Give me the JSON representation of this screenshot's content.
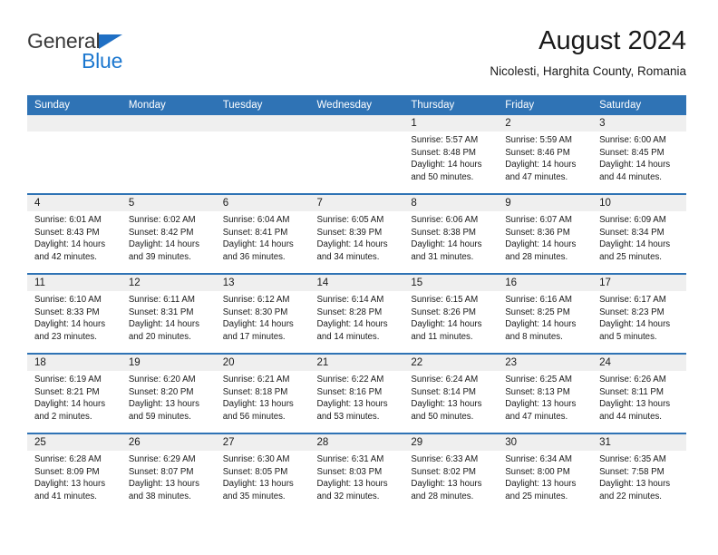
{
  "brand": {
    "name_part1": "General",
    "name_part2": "Blue",
    "triangle_color": "#1f6fc4",
    "blue_color": "#1b77cf"
  },
  "header": {
    "title": "August 2024",
    "subtitle": "Nicolesti, Harghita County, Romania"
  },
  "theme": {
    "header_bg": "#2f73b5",
    "daynum_bg": "#efefef",
    "row_separator": "#2f73b5",
    "text": "#1a1a1a"
  },
  "weekdays": [
    "Sunday",
    "Monday",
    "Tuesday",
    "Wednesday",
    "Thursday",
    "Friday",
    "Saturday"
  ],
  "labels": {
    "sunrise_prefix": "Sunrise:",
    "sunset_prefix": "Sunset:",
    "daylight_prefix": "Daylight:"
  },
  "weeks": [
    [
      {
        "day": "",
        "empty": true
      },
      {
        "day": "",
        "empty": true
      },
      {
        "day": "",
        "empty": true
      },
      {
        "day": "",
        "empty": true
      },
      {
        "day": "1",
        "sunrise": "Sunrise: 5:57 AM",
        "sunset": "Sunset: 8:48 PM",
        "daylight_1": "Daylight: 14 hours",
        "daylight_2": "and 50 minutes."
      },
      {
        "day": "2",
        "sunrise": "Sunrise: 5:59 AM",
        "sunset": "Sunset: 8:46 PM",
        "daylight_1": "Daylight: 14 hours",
        "daylight_2": "and 47 minutes."
      },
      {
        "day": "3",
        "sunrise": "Sunrise: 6:00 AM",
        "sunset": "Sunset: 8:45 PM",
        "daylight_1": "Daylight: 14 hours",
        "daylight_2": "and 44 minutes."
      }
    ],
    [
      {
        "day": "4",
        "sunrise": "Sunrise: 6:01 AM",
        "sunset": "Sunset: 8:43 PM",
        "daylight_1": "Daylight: 14 hours",
        "daylight_2": "and 42 minutes."
      },
      {
        "day": "5",
        "sunrise": "Sunrise: 6:02 AM",
        "sunset": "Sunset: 8:42 PM",
        "daylight_1": "Daylight: 14 hours",
        "daylight_2": "and 39 minutes."
      },
      {
        "day": "6",
        "sunrise": "Sunrise: 6:04 AM",
        "sunset": "Sunset: 8:41 PM",
        "daylight_1": "Daylight: 14 hours",
        "daylight_2": "and 36 minutes."
      },
      {
        "day": "7",
        "sunrise": "Sunrise: 6:05 AM",
        "sunset": "Sunset: 8:39 PM",
        "daylight_1": "Daylight: 14 hours",
        "daylight_2": "and 34 minutes."
      },
      {
        "day": "8",
        "sunrise": "Sunrise: 6:06 AM",
        "sunset": "Sunset: 8:38 PM",
        "daylight_1": "Daylight: 14 hours",
        "daylight_2": "and 31 minutes."
      },
      {
        "day": "9",
        "sunrise": "Sunrise: 6:07 AM",
        "sunset": "Sunset: 8:36 PM",
        "daylight_1": "Daylight: 14 hours",
        "daylight_2": "and 28 minutes."
      },
      {
        "day": "10",
        "sunrise": "Sunrise: 6:09 AM",
        "sunset": "Sunset: 8:34 PM",
        "daylight_1": "Daylight: 14 hours",
        "daylight_2": "and 25 minutes."
      }
    ],
    [
      {
        "day": "11",
        "sunrise": "Sunrise: 6:10 AM",
        "sunset": "Sunset: 8:33 PM",
        "daylight_1": "Daylight: 14 hours",
        "daylight_2": "and 23 minutes."
      },
      {
        "day": "12",
        "sunrise": "Sunrise: 6:11 AM",
        "sunset": "Sunset: 8:31 PM",
        "daylight_1": "Daylight: 14 hours",
        "daylight_2": "and 20 minutes."
      },
      {
        "day": "13",
        "sunrise": "Sunrise: 6:12 AM",
        "sunset": "Sunset: 8:30 PM",
        "daylight_1": "Daylight: 14 hours",
        "daylight_2": "and 17 minutes."
      },
      {
        "day": "14",
        "sunrise": "Sunrise: 6:14 AM",
        "sunset": "Sunset: 8:28 PM",
        "daylight_1": "Daylight: 14 hours",
        "daylight_2": "and 14 minutes."
      },
      {
        "day": "15",
        "sunrise": "Sunrise: 6:15 AM",
        "sunset": "Sunset: 8:26 PM",
        "daylight_1": "Daylight: 14 hours",
        "daylight_2": "and 11 minutes."
      },
      {
        "day": "16",
        "sunrise": "Sunrise: 6:16 AM",
        "sunset": "Sunset: 8:25 PM",
        "daylight_1": "Daylight: 14 hours",
        "daylight_2": "and 8 minutes."
      },
      {
        "day": "17",
        "sunrise": "Sunrise: 6:17 AM",
        "sunset": "Sunset: 8:23 PM",
        "daylight_1": "Daylight: 14 hours",
        "daylight_2": "and 5 minutes."
      }
    ],
    [
      {
        "day": "18",
        "sunrise": "Sunrise: 6:19 AM",
        "sunset": "Sunset: 8:21 PM",
        "daylight_1": "Daylight: 14 hours",
        "daylight_2": "and 2 minutes."
      },
      {
        "day": "19",
        "sunrise": "Sunrise: 6:20 AM",
        "sunset": "Sunset: 8:20 PM",
        "daylight_1": "Daylight: 13 hours",
        "daylight_2": "and 59 minutes."
      },
      {
        "day": "20",
        "sunrise": "Sunrise: 6:21 AM",
        "sunset": "Sunset: 8:18 PM",
        "daylight_1": "Daylight: 13 hours",
        "daylight_2": "and 56 minutes."
      },
      {
        "day": "21",
        "sunrise": "Sunrise: 6:22 AM",
        "sunset": "Sunset: 8:16 PM",
        "daylight_1": "Daylight: 13 hours",
        "daylight_2": "and 53 minutes."
      },
      {
        "day": "22",
        "sunrise": "Sunrise: 6:24 AM",
        "sunset": "Sunset: 8:14 PM",
        "daylight_1": "Daylight: 13 hours",
        "daylight_2": "and 50 minutes."
      },
      {
        "day": "23",
        "sunrise": "Sunrise: 6:25 AM",
        "sunset": "Sunset: 8:13 PM",
        "daylight_1": "Daylight: 13 hours",
        "daylight_2": "and 47 minutes."
      },
      {
        "day": "24",
        "sunrise": "Sunrise: 6:26 AM",
        "sunset": "Sunset: 8:11 PM",
        "daylight_1": "Daylight: 13 hours",
        "daylight_2": "and 44 minutes."
      }
    ],
    [
      {
        "day": "25",
        "sunrise": "Sunrise: 6:28 AM",
        "sunset": "Sunset: 8:09 PM",
        "daylight_1": "Daylight: 13 hours",
        "daylight_2": "and 41 minutes."
      },
      {
        "day": "26",
        "sunrise": "Sunrise: 6:29 AM",
        "sunset": "Sunset: 8:07 PM",
        "daylight_1": "Daylight: 13 hours",
        "daylight_2": "and 38 minutes."
      },
      {
        "day": "27",
        "sunrise": "Sunrise: 6:30 AM",
        "sunset": "Sunset: 8:05 PM",
        "daylight_1": "Daylight: 13 hours",
        "daylight_2": "and 35 minutes."
      },
      {
        "day": "28",
        "sunrise": "Sunrise: 6:31 AM",
        "sunset": "Sunset: 8:03 PM",
        "daylight_1": "Daylight: 13 hours",
        "daylight_2": "and 32 minutes."
      },
      {
        "day": "29",
        "sunrise": "Sunrise: 6:33 AM",
        "sunset": "Sunset: 8:02 PM",
        "daylight_1": "Daylight: 13 hours",
        "daylight_2": "and 28 minutes."
      },
      {
        "day": "30",
        "sunrise": "Sunrise: 6:34 AM",
        "sunset": "Sunset: 8:00 PM",
        "daylight_1": "Daylight: 13 hours",
        "daylight_2": "and 25 minutes."
      },
      {
        "day": "31",
        "sunrise": "Sunrise: 6:35 AM",
        "sunset": "Sunset: 7:58 PM",
        "daylight_1": "Daylight: 13 hours",
        "daylight_2": "and 22 minutes."
      }
    ]
  ]
}
